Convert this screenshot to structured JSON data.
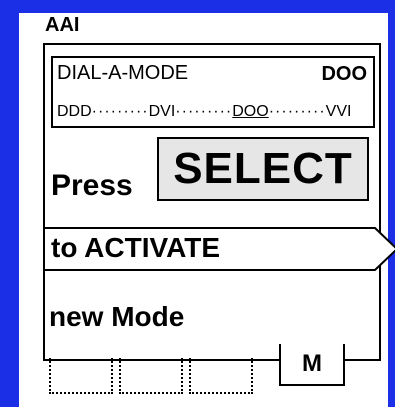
{
  "screen": {
    "title": "AAI",
    "mode_box": {
      "label": "DIAL-A-MODE",
      "current_mode": "DOO",
      "sequence": [
        "DDD",
        "DVI",
        "DOO",
        "VVI"
      ],
      "selected_index": 2,
      "separator": "·········"
    },
    "instruction": {
      "press_label": "Press",
      "select_button_label": "SELECT",
      "activate_label": "to  ACTIVATE",
      "new_mode_label": "new Mode"
    },
    "softkeys": {
      "m_label": "M"
    }
  },
  "colors": {
    "background": "#1a2fe6",
    "panel": "#ffffff",
    "select_button": "#e6e6e6"
  }
}
